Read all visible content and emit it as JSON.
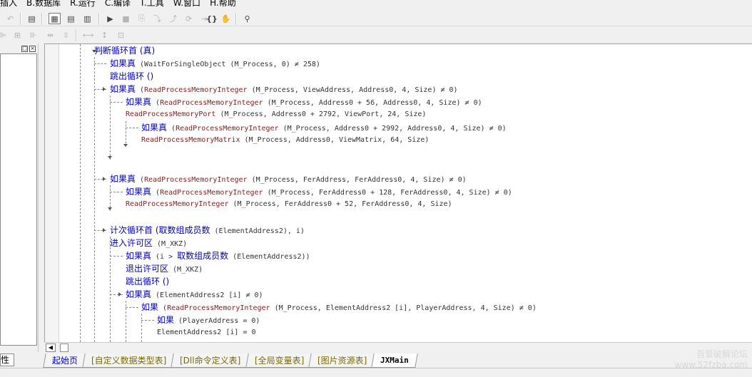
{
  "menu": {
    "items": [
      "插入",
      "B.数据库",
      "R.运行",
      "C.编译",
      "T.工具",
      "W.窗口",
      "H.帮助"
    ]
  },
  "toolbar1": {
    "icons": [
      "undo-icon",
      "find-icon",
      "layout-workspace-icon",
      "layout-output-icon",
      "layout-both-icon",
      "run-icon",
      "stop-icon",
      "step-icon",
      "step-into-icon",
      "step-out-icon",
      "step-over-icon",
      "step-cursor-icon",
      "hand-icon",
      "binoculars-icon"
    ]
  },
  "toolbar2": {
    "icons": [
      "align-left-icon",
      "align-center-icon",
      "align-right-icon",
      "space-h-icon",
      "space-v-icon",
      "width-icon",
      "height-icon",
      "size-icon"
    ]
  },
  "left_panel": {
    "tab_label": "性",
    "restore_glyph": "□",
    "close_glyph": "×"
  },
  "code": {
    "lines": [
      [
        {
          "t": "kw",
          "v": "判断循环首 (真)"
        }
      ],
      [
        {
          "t": "kw",
          "v": "如果真"
        },
        {
          "t": "ar",
          "v": " (WaitForSingleObject (M_Process, 0) ≠ 258)"
        }
      ],
      [
        {
          "t": "kw",
          "v": "跳出循环 ()"
        }
      ],
      [
        {
          "t": "kw",
          "v": "如果真"
        },
        {
          "t": "ar",
          "v": " ("
        },
        {
          "t": "fn",
          "v": "ReadProcessMemoryInteger"
        },
        {
          "t": "ar",
          "v": " (M_Process, ViewAddress, Address0, 4, Size) ≠ 0)"
        }
      ],
      [
        {
          "t": "kw",
          "v": "如果真"
        },
        {
          "t": "ar",
          "v": " ("
        },
        {
          "t": "fn",
          "v": "ReadProcessMemoryInteger"
        },
        {
          "t": "ar",
          "v": " (M_Process, Address0 + 56, Address0, 4, Size) ≠ 0)"
        }
      ],
      [
        {
          "t": "fn",
          "v": "ReadProcessMemoryPort"
        },
        {
          "t": "ar",
          "v": " (M_Process, Address0 + 2792, ViewPort, 24, Size)"
        }
      ],
      [
        {
          "t": "kw",
          "v": "如果真"
        },
        {
          "t": "ar",
          "v": " ("
        },
        {
          "t": "fn",
          "v": "ReadProcessMemoryInteger"
        },
        {
          "t": "ar",
          "v": " (M_Process, Address0 + 2992, Address0, 4, Size) ≠ 0)"
        }
      ],
      [
        {
          "t": "fn",
          "v": "ReadProcessMemoryMatrix"
        },
        {
          "t": "ar",
          "v": " (M_Process, Address0, ViewMatrix, 64, Size)"
        }
      ],
      [],
      [],
      [
        {
          "t": "kw",
          "v": "如果真"
        },
        {
          "t": "ar",
          "v": " ("
        },
        {
          "t": "fn",
          "v": "ReadProcessMemoryInteger"
        },
        {
          "t": "ar",
          "v": " (M_Process, FerAddress, FerAddress0, 4, Size) ≠ 0)"
        }
      ],
      [
        {
          "t": "kw",
          "v": "如果真"
        },
        {
          "t": "ar",
          "v": " ("
        },
        {
          "t": "fn",
          "v": "ReadProcessMemoryInteger"
        },
        {
          "t": "ar",
          "v": " (M_Process, FerAddress0 + 128, FerAddress0, 4, Size) ≠ 0)"
        }
      ],
      [
        {
          "t": "fn",
          "v": "ReadProcessMemoryInteger"
        },
        {
          "t": "ar",
          "v": " (M_Process, FerAddress0 + 52, FerAddress0, 4, Size)"
        }
      ],
      [],
      [
        {
          "t": "kw",
          "v": "计次循环首 (取数组成员数"
        },
        {
          "t": "ar",
          "v": " (ElementAddress2), i)"
        }
      ],
      [
        {
          "t": "kw",
          "v": "进入许可区"
        },
        {
          "t": "ar",
          "v": " (M_XKZ)"
        }
      ],
      [
        {
          "t": "kw",
          "v": "如果真"
        },
        {
          "t": "ar",
          "v": " (i > "
        },
        {
          "t": "kw",
          "v": "取数组成员数"
        },
        {
          "t": "ar",
          "v": " (ElementAddress2))"
        }
      ],
      [
        {
          "t": "kw",
          "v": "退出许可区"
        },
        {
          "t": "ar",
          "v": " (M_XKZ)"
        }
      ],
      [
        {
          "t": "kw",
          "v": "跳出循环 ()"
        }
      ],
      [
        {
          "t": "kw",
          "v": "如果真"
        },
        {
          "t": "ar",
          "v": " (ElementAddress2 [i] ≠ 0)"
        }
      ],
      [
        {
          "t": "kw",
          "v": "如果"
        },
        {
          "t": "ar",
          "v": " ("
        },
        {
          "t": "fn",
          "v": "ReadProcessMemoryInteger"
        },
        {
          "t": "ar",
          "v": " (M_Process, ElementAddress2 [i], PlayerAddress, 4, Size) ≠ 0)"
        }
      ],
      [
        {
          "t": "kw",
          "v": "如果"
        },
        {
          "t": "ar",
          "v": " (PlayerAddress = 0)"
        }
      ],
      [
        {
          "t": "ar",
          "v": "ElementAddress2 [i] = 0"
        }
      ]
    ]
  },
  "tabs": [
    "起始页",
    "[自定义数据类型表]",
    "[Dll命令定义表]",
    "[全局变量表]",
    "[图片资源表]",
    "JXMain"
  ],
  "watermark": {
    "line1": "吾爱破解论坛",
    "line2": "www.52fzba.com"
  }
}
